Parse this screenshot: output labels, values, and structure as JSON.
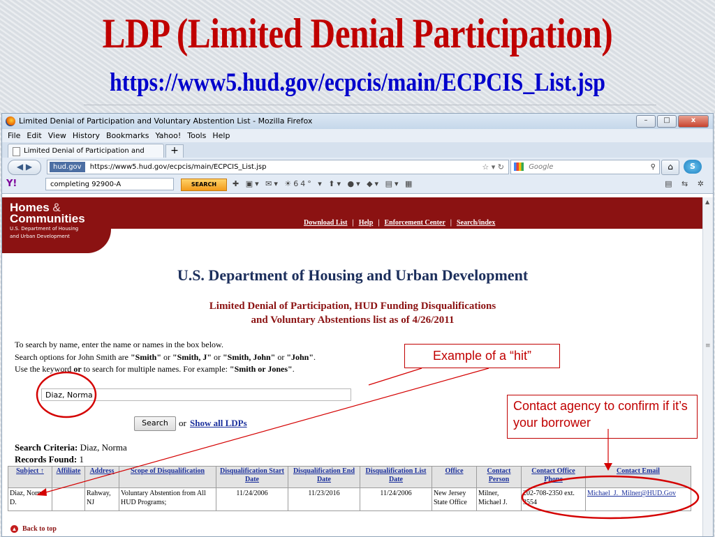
{
  "slide": {
    "title": "LDP (Limited Denial Participation)",
    "subtitle": "https://www5.hud.gov/ecpcis/main/ECPCIS_List.jsp"
  },
  "browser": {
    "window_title": "Limited Denial of Participation and Voluntary Abstention List - Mozilla Firefox",
    "window_buttons": [
      "–",
      "□",
      "x"
    ],
    "menu": [
      "File",
      "Edit",
      "View",
      "History",
      "Bookmarks",
      "Yahoo!",
      "Tools",
      "Help"
    ],
    "tab_label": "Limited Denial of Participation and Volu...",
    "new_tab": "+",
    "site_badge": "hud.gov",
    "url": "https://www5.hud.gov/ecpcis/main/ECPCIS_List.jsp",
    "search_placeholder": "Google",
    "yahoo_logo": "Y!",
    "yahoo_search_value": "completing 92900-A",
    "yahoo_search_button": "SEARCH",
    "yahoo_badge": "64°"
  },
  "hud": {
    "logo_line1": "Homes",
    "logo_amp": "&",
    "logo_line2": "Communities",
    "logo_line3": "U.S. Department of Housing",
    "logo_line4": "and Urban Development",
    "nav": [
      "Download List",
      "Help",
      "Enforcement Center",
      "Search/index"
    ],
    "dept_title": "U.S. Department of Housing and Urban Development",
    "list_title_1": "Limited Denial of Participation, HUD Funding Disqualifications",
    "list_title_2": "and Voluntary Abstentions list as of 4/26/2011"
  },
  "instructions": {
    "line1": "To search by name, enter the name or names in the box below.",
    "line2_a": "Search options for John Smith are ",
    "opt1": "\"Smith\"",
    "or1": " or ",
    "opt2": "\"Smith, J\"",
    "or2": " or ",
    "opt3": "\"Smith, John\"",
    "or3": " or ",
    "opt4": "\"John\"",
    "end2": ".",
    "line3_a": "Use the keyword ",
    "kw": "or",
    "line3_b": " to search for multiple names. For example: ",
    "example": "\"Smith or Jones\"",
    "end3": "."
  },
  "search": {
    "value": "Diaz, Norma",
    "button": "Search",
    "or": "or",
    "show_all": "Show all LDPs"
  },
  "criteria": {
    "criteria_label": "Search Criteria:",
    "criteria_value": " Diaz, Norma",
    "records_label": "Records Found:",
    "records_value": " 1"
  },
  "table": {
    "headers": [
      "Subject ↑",
      "Affiliate",
      "Address",
      "Scope of Disqualification",
      "Disqualification Start Date",
      "Disqualification End Date",
      "Disqualification List Date",
      "Office",
      "Contact Person",
      "Contact Office Phone",
      "Contact Email"
    ],
    "row": [
      "Diaz, Norma D.",
      "",
      "Rahway, NJ",
      "Voluntary Abstention from All HUD Programs;",
      "11/24/2006",
      "11/23/2016",
      "11/24/2006",
      "New Jersey State Office",
      "Milner, Michael J.",
      "202-708-2350 ext. 3554",
      "Michael_J._Milner@HUD.Gov"
    ]
  },
  "back_to_top": "Back to top",
  "callouts": {
    "hit": "Example of a “hit”",
    "contact": "Contact agency to confirm if it’s your borrower"
  },
  "colors": {
    "title_red": "#c00000",
    "subtitle_blue": "#0000cc",
    "hud_maroon": "#8b1212",
    "link_blue": "#1a2f9c"
  }
}
